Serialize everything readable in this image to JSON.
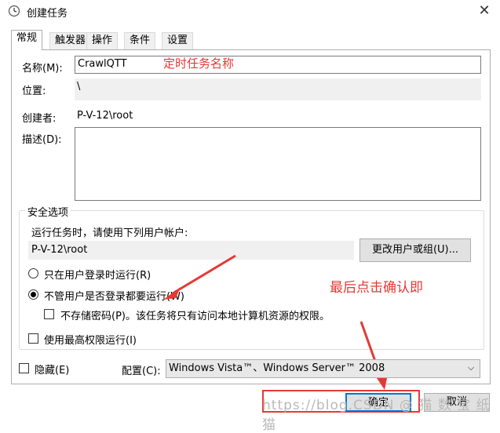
{
  "window": {
    "title": "创建任务",
    "close_icon": "close-icon"
  },
  "tabs": [
    {
      "label": "常规",
      "active": true
    },
    {
      "label": "触发器"
    },
    {
      "label": "操作"
    },
    {
      "label": "条件"
    },
    {
      "label": "设置"
    }
  ],
  "general": {
    "name_label": "名称(M):",
    "name_value": "CrawlQTT",
    "location_label": "位置:",
    "location_value": "\\",
    "author_label": "创建者:",
    "author_value": "P-V-12\\root",
    "description_label": "描述(D):",
    "description_value": ""
  },
  "security": {
    "title": "安全选项",
    "run_as_label": "运行任务时，请使用下列用户帐户:",
    "run_as_value": "P-V-12\\root",
    "change_user_button": "更改用户或组(U)...",
    "radio_logged_on": "只在用户登录时运行(R)",
    "radio_whether_logged": "不管用户是否登录都要运行(W)",
    "checkbox_no_store_password": "不存储密码(P)。该任务将只有访问本地计算机资源的权限。",
    "checkbox_highest_privileges": "使用最高权限运行(I)",
    "selected_radio": "radio_whether_logged"
  },
  "footer": {
    "hidden_label": "隐藏(E)",
    "configure_label": "配置(C):",
    "configure_value": "Windows Vista™、Windows Server™ 2008",
    "ok_button": "确定",
    "cancel_button": "取消"
  },
  "annotations": {
    "task_name_note": "定时任务名称",
    "click_ok_note": "最后点击确认即"
  },
  "watermark": "https://blog.CSDN @ 猫 数 宝 纸猫",
  "colors": {
    "annotation": "#e53935",
    "highlight_box": "#e53935",
    "ok_focus": "#0078d7"
  }
}
